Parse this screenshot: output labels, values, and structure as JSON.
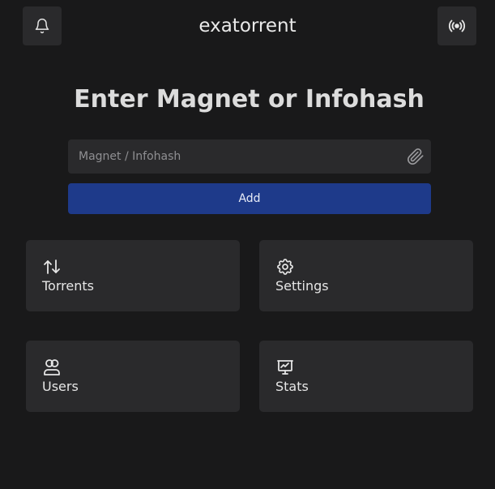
{
  "header": {
    "title": "exatorrent",
    "left_icon": "bell-icon",
    "right_icon": "broadcast-icon"
  },
  "main": {
    "heading": "Enter Magnet or Infohash",
    "magnet_input": {
      "placeholder": "Magnet / Infohash",
      "value": ""
    },
    "attach_icon": "paperclip-icon",
    "add_label": "Add",
    "cards": [
      {
        "label": "Torrents",
        "icon": "arrows-up-down-icon"
      },
      {
        "label": "Settings",
        "icon": "gear-icon"
      },
      {
        "label": "Users",
        "icon": "users-icon"
      },
      {
        "label": "Stats",
        "icon": "chart-presentation-icon"
      }
    ]
  },
  "colors": {
    "background": "#19191a",
    "surface": "#2a2a2c",
    "accent": "#1e3a8a"
  }
}
